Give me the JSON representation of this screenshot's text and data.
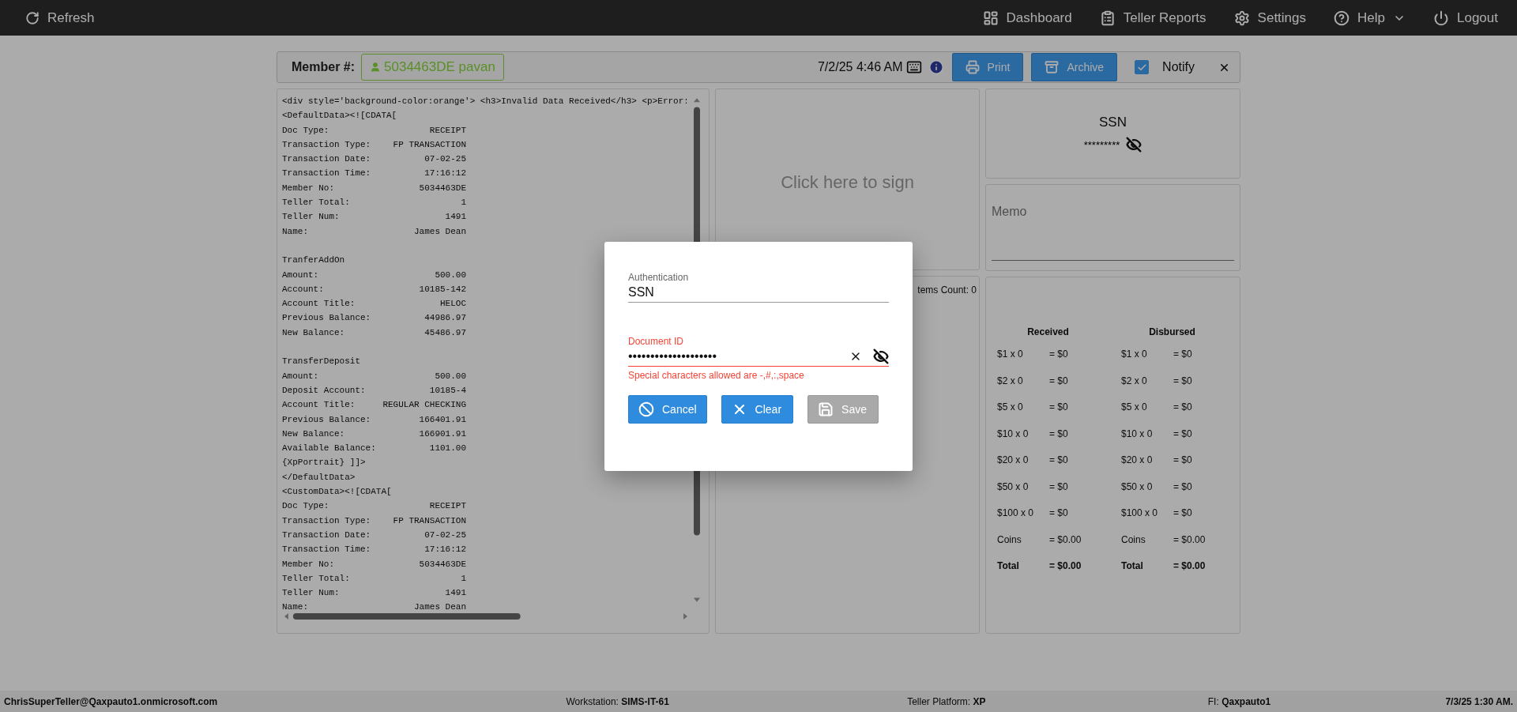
{
  "topbar": {
    "left": [
      {
        "label": "Refresh"
      }
    ],
    "right": [
      {
        "label": "Dashboard",
        "dropdown": false
      },
      {
        "label": "Teller Reports",
        "dropdown": false
      },
      {
        "label": "Settings",
        "dropdown": false
      },
      {
        "label": "Help",
        "dropdown": true
      },
      {
        "label": "Logout",
        "dropdown": false
      }
    ]
  },
  "member_bar": {
    "label": "Member #:",
    "member": "5034463DE pavan",
    "datetime": "7/2/25 4:46 AM",
    "buttons": [
      {
        "label": "Print"
      },
      {
        "label": "Archive"
      }
    ],
    "notify": {
      "label": "Notify",
      "checked": true
    }
  },
  "receipt": {
    "lines": [
      {
        "kind": "text",
        "text": "<div style='background-color:orange'> <h3>Invalid Data Received</h3> <p>Error:"
      },
      {
        "kind": "text",
        "text": "<DefaultData><![CDATA["
      },
      {
        "kind": "pair",
        "label": "Doc Type:",
        "value": "RECEIPT"
      },
      {
        "kind": "pair",
        "label": "Transaction Type:",
        "value": "FP TRANSACTION"
      },
      {
        "kind": "pair",
        "label": "Transaction Date:",
        "value": "07-02-25"
      },
      {
        "kind": "pair",
        "label": "Transaction Time:",
        "value": "17:16:12"
      },
      {
        "kind": "pair",
        "label": "Member No:",
        "value": "5034463DE"
      },
      {
        "kind": "pair",
        "label": "Teller Total:",
        "value": "1"
      },
      {
        "kind": "pair",
        "label": "Teller Num:",
        "value": "1491"
      },
      {
        "kind": "pair",
        "label": "Name:",
        "value": "James Dean"
      },
      {
        "kind": "blank"
      },
      {
        "kind": "text",
        "text": "TranferAddOn"
      },
      {
        "kind": "pair",
        "label": "Amount:",
        "value": "500.00"
      },
      {
        "kind": "pair",
        "label": "Account:",
        "value": "10185-142"
      },
      {
        "kind": "pair",
        "label": "Account Title:",
        "value": "HELOC"
      },
      {
        "kind": "pair",
        "label": "Previous Balance:",
        "value": "44986.97"
      },
      {
        "kind": "pair",
        "label": "New Balance:",
        "value": "45486.97"
      },
      {
        "kind": "blank"
      },
      {
        "kind": "text",
        "text": "TransferDeposit"
      },
      {
        "kind": "pair",
        "label": "Amount:",
        "value": "500.00"
      },
      {
        "kind": "pair",
        "label": "Deposit Account:",
        "value": "10185-4"
      },
      {
        "kind": "pair",
        "label": "Account Title:",
        "value": "REGULAR CHECKING"
      },
      {
        "kind": "pair",
        "label": "Previous Balance:",
        "value": "166401.91"
      },
      {
        "kind": "pair",
        "label": "New Balance:",
        "value": "166901.91"
      },
      {
        "kind": "pair",
        "label": "Available Balance:",
        "value": "1101.00"
      },
      {
        "kind": "text",
        "text": "{XpPortrait} ]]>"
      },
      {
        "kind": "text",
        "text": "</DefaultData>"
      },
      {
        "kind": "text",
        "text": "<CustomData><![CDATA["
      },
      {
        "kind": "pair",
        "label": "Doc Type:",
        "value": "RECEIPT"
      },
      {
        "kind": "pair",
        "label": "Transaction Type:",
        "value": "FP TRANSACTION"
      },
      {
        "kind": "pair",
        "label": "Transaction Date:",
        "value": "07-02-25"
      },
      {
        "kind": "pair",
        "label": "Transaction Time:",
        "value": "17:16:12"
      },
      {
        "kind": "pair",
        "label": "Member No:",
        "value": "5034463DE"
      },
      {
        "kind": "pair",
        "label": "Teller Total:",
        "value": "1"
      },
      {
        "kind": "pair",
        "label": "Teller Num:",
        "value": "1491"
      },
      {
        "kind": "pair",
        "label": "Name:",
        "value": "James Dean"
      }
    ]
  },
  "signature": {
    "prompt": "Click here to sign"
  },
  "items": {
    "count": "tems Count: 0"
  },
  "ssn": {
    "title": "SSN",
    "value": "*********"
  },
  "memo": {
    "placeholder": "Memo"
  },
  "cash": {
    "columns": [
      {
        "header": "Received",
        "rows": [
          {
            "kind": "row",
            "label": "$1 x 0",
            "value": "= $0"
          },
          {
            "kind": "row",
            "label": "$2 x 0",
            "value": "= $0"
          },
          {
            "kind": "row",
            "label": "$5 x 0",
            "value": "= $0"
          },
          {
            "kind": "row",
            "label": "$10 x 0",
            "value": "= $0"
          },
          {
            "kind": "row",
            "label": "$20 x 0",
            "value": "= $0"
          },
          {
            "kind": "row",
            "label": "$50 x 0",
            "value": "= $0"
          },
          {
            "kind": "row",
            "label": "$100 x 0",
            "value": "= $0"
          },
          {
            "kind": "row",
            "label": "Coins",
            "value": "= $0.00"
          },
          {
            "kind": "total",
            "label": "Total",
            "value": "= $0.00"
          }
        ]
      },
      {
        "header": "Disbursed",
        "rows": [
          {
            "kind": "row",
            "label": "$1 x 0",
            "value": "= $0"
          },
          {
            "kind": "row",
            "label": "$2 x 0",
            "value": "= $0"
          },
          {
            "kind": "row",
            "label": "$5 x 0",
            "value": "= $0"
          },
          {
            "kind": "row",
            "label": "$10 x 0",
            "value": "= $0"
          },
          {
            "kind": "row",
            "label": "$20 x 0",
            "value": "= $0"
          },
          {
            "kind": "row",
            "label": "$50 x 0",
            "value": "= $0"
          },
          {
            "kind": "row",
            "label": "$100 x 0",
            "value": "= $0"
          },
          {
            "kind": "row",
            "label": "Coins",
            "value": "= $0.00"
          },
          {
            "kind": "total",
            "label": "Total",
            "value": "= $0.00"
          }
        ]
      }
    ]
  },
  "dialog": {
    "fields": [
      {
        "label": "Authentication",
        "value": "SSN",
        "error": false,
        "clearable": false
      },
      {
        "label": "Document ID",
        "value": "••••••••••••••••••••",
        "error": true,
        "clearable": true,
        "error_text": "Special characters allowed are -,#,:,space"
      }
    ],
    "buttons": [
      {
        "label": "Cancel",
        "disabled": false
      },
      {
        "label": "Clear",
        "disabled": false
      },
      {
        "label": "Save",
        "disabled": true
      }
    ]
  },
  "status_bar": [
    {
      "value": "ChrisSuperTeller@Qaxpauto1.onmicrosoft.com"
    },
    {
      "label": "Workstation: ",
      "value": "SIMS-IT-61"
    },
    {
      "label": "Teller Platform: ",
      "value": "XP"
    },
    {
      "label": "FI: ",
      "value": "Qaxpauto1"
    },
    {
      "value": "7/3/25 1:30 AM."
    }
  ]
}
